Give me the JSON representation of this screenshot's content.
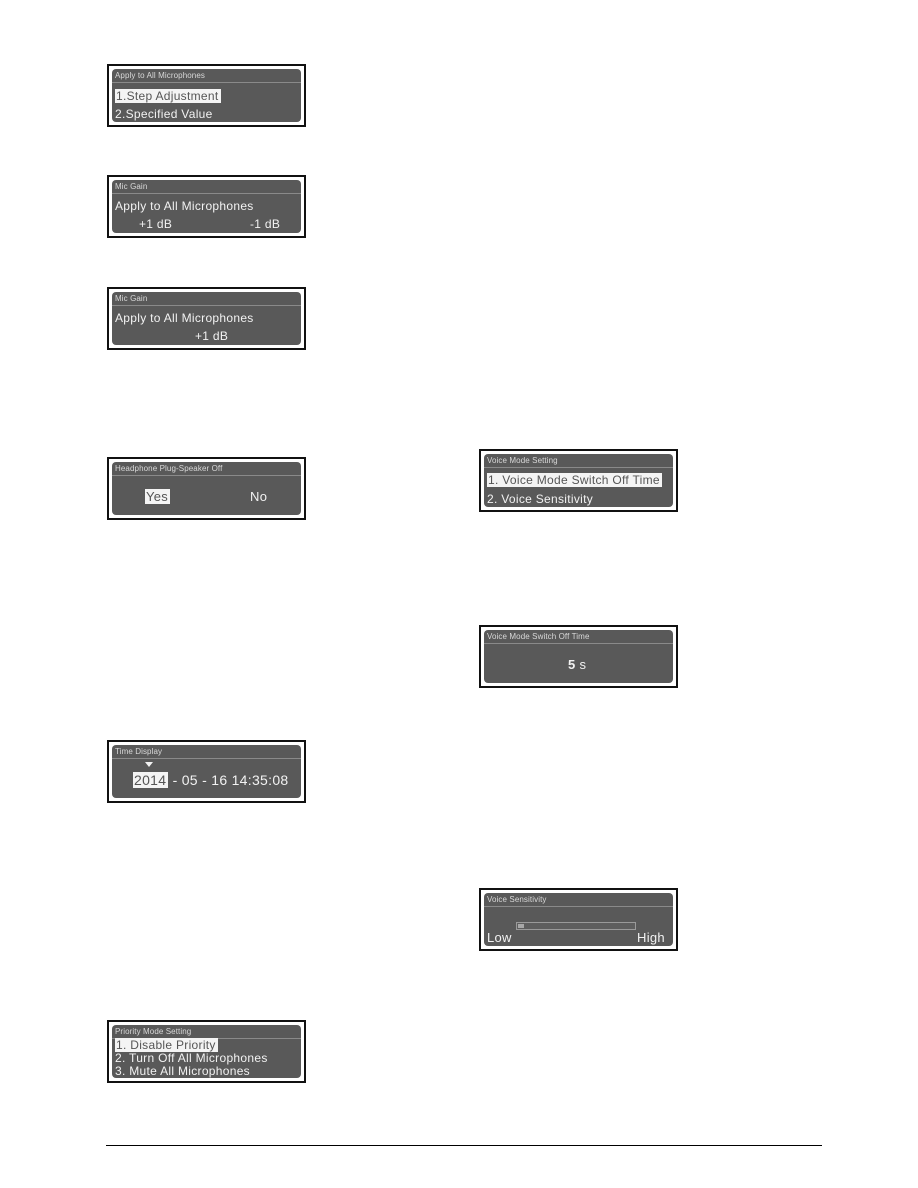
{
  "panels": {
    "apply_all": {
      "title": "Apply to All Microphones",
      "items": [
        "1.Step Adjustment",
        "2.Specified Value"
      ],
      "selected_index": 0
    },
    "mic_gain_step": {
      "title": "Mic Gain",
      "text": "Apply to All Microphones",
      "left_value": "+1 dB",
      "right_value": "-1 dB"
    },
    "mic_gain_value": {
      "title": "Mic Gain",
      "text": "Apply to All Microphones",
      "value": "+1 dB"
    },
    "headphone": {
      "title": "Headphone Plug-Speaker Off",
      "yes": "Yes",
      "no": "No",
      "selected": "Yes"
    },
    "time_display": {
      "title": "Time Display",
      "year": "2014",
      "rest": "- 05 - 16  14:35:08",
      "cursor_icon": "triangle-down-icon"
    },
    "priority": {
      "title": "Priority Mode Setting",
      "items": [
        "1. Disable Priority",
        "2. Turn Off All Microphones",
        "3. Mute All Microphones"
      ],
      "selected_index": 0
    },
    "voice_mode": {
      "title": "Voice Mode Setting",
      "items": [
        "1. Voice Mode Switch Off Time",
        "2. Voice Sensitivity"
      ],
      "selected_index": 0
    },
    "switch_off_time": {
      "title": "Voice Mode Switch Off Time",
      "value": "5",
      "unit": "s"
    },
    "sensitivity": {
      "title": "Voice Sensitivity",
      "low_label": "Low",
      "high_label": "High",
      "level_fraction": 0.05
    }
  }
}
